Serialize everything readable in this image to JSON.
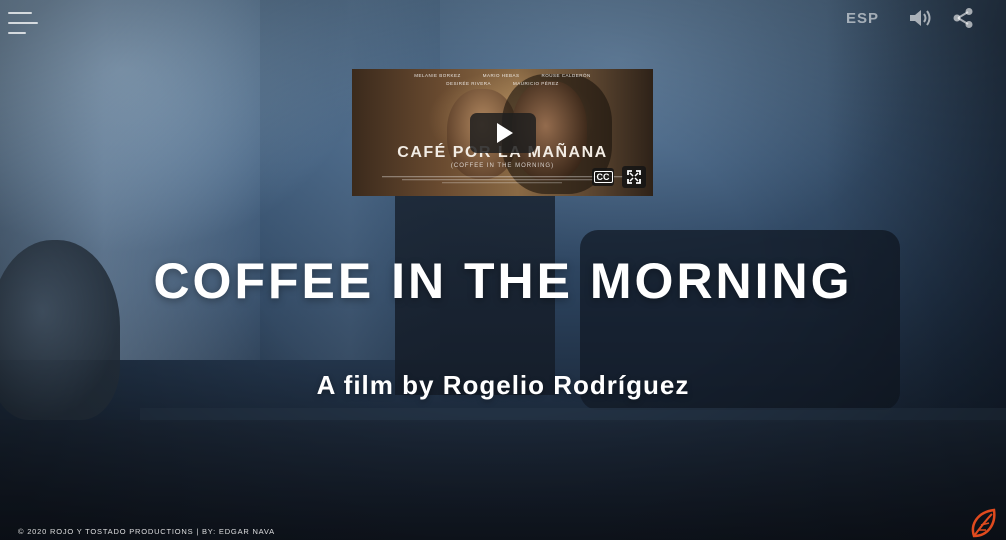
{
  "header": {
    "menu_icon": "hamburger-icon",
    "language_label": "ESP",
    "sound_icon": "speaker-volume-icon",
    "share_icon": "share-icon"
  },
  "video": {
    "credits_row1": [
      "MELANIE BORKEZ",
      "MARIO HEBAS",
      "ROUSE CALDERÓN"
    ],
    "credits_row2": [
      "DESIRÉE RIVERA",
      "MAURICIO PÉREZ"
    ],
    "title": "CAFÉ POR LA MAÑANA",
    "subtitle": "(COFFEE IN THE MORNING)",
    "cc_label": "CC",
    "play_icon": "play-icon",
    "fullscreen_icon": "fullscreen-icon"
  },
  "hero": {
    "title": "COFFEE IN THE MORNING",
    "byline": "A film by Rogelio Rodríguez"
  },
  "footer": {
    "copyright": "© 2020 ROJO Y TOSTADO PRODUCTIONS | BY: EDGAR NAVA",
    "logo_icon": "leaf-logo-icon"
  },
  "colors": {
    "accent_logo": "#e04a1e",
    "text": "#ffffff"
  }
}
